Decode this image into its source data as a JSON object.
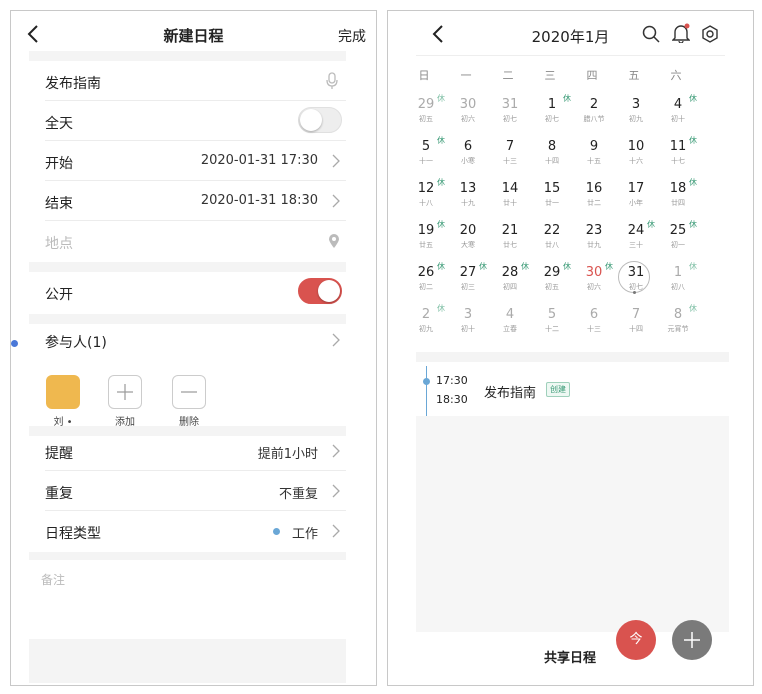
{
  "left": {
    "header": {
      "title": "新建日程",
      "done_label": "完成"
    },
    "title_field": {
      "value": "发布指南"
    },
    "allday": {
      "label": "全天",
      "on": false
    },
    "start": {
      "label": "开始",
      "value": "2020-01-31 17:30"
    },
    "end": {
      "label": "结束",
      "value": "2020-01-31 18:30"
    },
    "location": {
      "placeholder": "地点"
    },
    "public": {
      "label": "公开",
      "on": true
    },
    "participants": {
      "label": "参与人(1)",
      "people": [
        {
          "caption": "刘 •",
          "color": "#efb84f"
        },
        {
          "caption": "添加",
          "icon": "plus-icon"
        },
        {
          "caption": "删除",
          "icon": "minus-icon"
        }
      ]
    },
    "reminder": {
      "label": "提醒",
      "value": "提前1小时"
    },
    "repeat": {
      "label": "重复",
      "value": "不重复"
    },
    "type": {
      "label": "日程类型",
      "value": "工作",
      "dot_color": "#6aa7d6"
    },
    "notes": {
      "placeholder": "备注"
    }
  },
  "right": {
    "header": {
      "title": "2020年1月"
    },
    "weekdays": [
      "日",
      "一",
      "二",
      "三",
      "四",
      "五",
      "六"
    ],
    "weeks": [
      [
        {
          "n": "29",
          "s": "初五",
          "h": "休",
          "dim": true
        },
        {
          "n": "30",
          "s": "初六",
          "dim": true
        },
        {
          "n": "31",
          "s": "初七",
          "dim": true
        },
        {
          "n": "1",
          "s": "初七",
          "h": "休"
        },
        {
          "n": "2",
          "s": "腊八节"
        },
        {
          "n": "3",
          "s": "初九"
        },
        {
          "n": "4",
          "s": "初十",
          "h": "休"
        }
      ],
      [
        {
          "n": "5",
          "s": "十一",
          "h": "休"
        },
        {
          "n": "6",
          "s": "小寒"
        },
        {
          "n": "7",
          "s": "十三"
        },
        {
          "n": "8",
          "s": "十四"
        },
        {
          "n": "9",
          "s": "十五"
        },
        {
          "n": "10",
          "s": "十六"
        },
        {
          "n": "11",
          "s": "十七",
          "h": "休"
        }
      ],
      [
        {
          "n": "12",
          "s": "十八",
          "h": "休"
        },
        {
          "n": "13",
          "s": "十九"
        },
        {
          "n": "14",
          "s": "廿十"
        },
        {
          "n": "15",
          "s": "廿一"
        },
        {
          "n": "16",
          "s": "廿二"
        },
        {
          "n": "17",
          "s": "小年"
        },
        {
          "n": "18",
          "s": "廿四",
          "h": "休"
        }
      ],
      [
        {
          "n": "19",
          "s": "廿五",
          "h": "休"
        },
        {
          "n": "20",
          "s": "大寒"
        },
        {
          "n": "21",
          "s": "廿七"
        },
        {
          "n": "22",
          "s": "廿八"
        },
        {
          "n": "23",
          "s": "廿九"
        },
        {
          "n": "24",
          "s": "三十",
          "h": "休"
        },
        {
          "n": "25",
          "s": "初一",
          "h": "休"
        }
      ],
      [
        {
          "n": "26",
          "s": "初二",
          "h": "休"
        },
        {
          "n": "27",
          "s": "初三",
          "h": "休"
        },
        {
          "n": "28",
          "s": "初四",
          "h": "休"
        },
        {
          "n": "29",
          "s": "初五",
          "h": "休"
        },
        {
          "n": "30",
          "s": "初六",
          "h": "休",
          "red": true
        },
        {
          "n": "31",
          "s": "初七",
          "today": true
        },
        {
          "n": "1",
          "s": "初八",
          "h": "休",
          "dim": true
        }
      ],
      [
        {
          "n": "2",
          "s": "初九",
          "h": "休",
          "dim": true
        },
        {
          "n": "3",
          "s": "初十",
          "dim": true
        },
        {
          "n": "4",
          "s": "立春",
          "dim": true
        },
        {
          "n": "5",
          "s": "十二",
          "dim": true
        },
        {
          "n": "6",
          "s": "十三",
          "dim": true
        },
        {
          "n": "7",
          "s": "十四",
          "dim": true
        },
        {
          "n": "8",
          "s": "元宵节",
          "h": "休",
          "dim": true
        }
      ]
    ],
    "event": {
      "start": "17:30",
      "end": "18:30",
      "title": "发布指南",
      "badge": "创建"
    },
    "footer": {
      "label": "共享日程",
      "today_btn": "今"
    },
    "colors": {
      "holiday": "#3a9a76",
      "fab_red": "#d9534f",
      "fab_gray": "#7a7a7a",
      "timeline": "#6aa7d6"
    }
  }
}
